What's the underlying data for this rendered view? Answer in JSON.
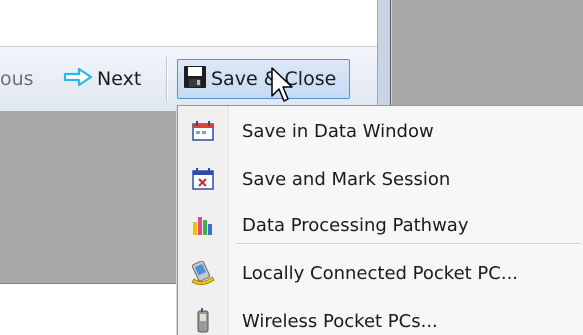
{
  "toolbar": {
    "previous_label": "ous",
    "next_label": "Next",
    "save_close_label": "Save & Close"
  },
  "menu": {
    "items": [
      {
        "label": "Save in Data Window",
        "icon": "calendar-icon"
      },
      {
        "label": "Save and Mark Session",
        "icon": "calendar-mark-icon"
      },
      {
        "label": "Data Processing Pathway",
        "icon": "bar-chart-icon"
      },
      {
        "label": "Locally Connected Pocket PC...",
        "icon": "pocket-pc-cradle-icon"
      },
      {
        "label": "Wireless Pocket PCs...",
        "icon": "wireless-device-icon"
      }
    ]
  },
  "colors": {
    "accent": "#5c8fd1",
    "next_arrow": "#29b7e8",
    "panel_gray": "#a9a9a9"
  }
}
